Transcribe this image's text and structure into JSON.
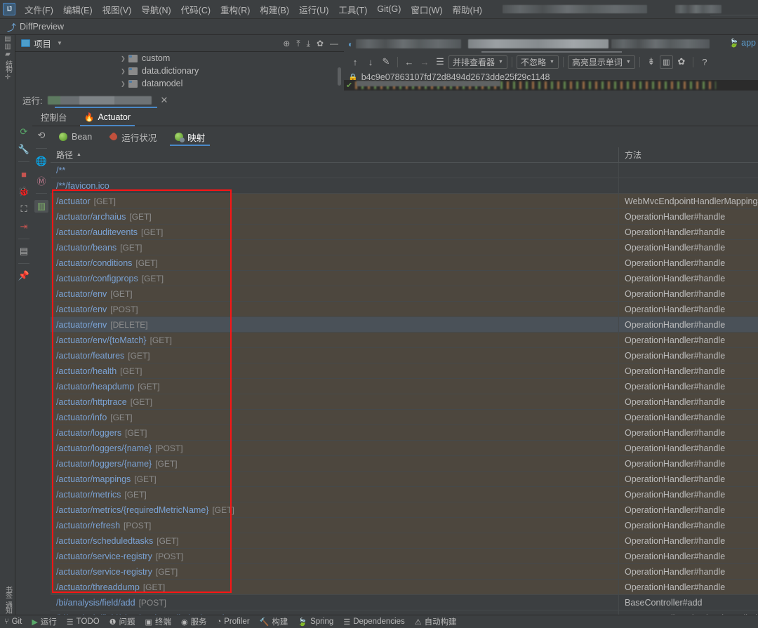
{
  "menubar": {
    "logo": "IJ",
    "items": [
      {
        "label": "文件(F)"
      },
      {
        "label": "编辑(E)"
      },
      {
        "label": "视图(V)"
      },
      {
        "label": "导航(N)"
      },
      {
        "label": "代码(C)"
      },
      {
        "label": "重构(R)"
      },
      {
        "label": "构建(B)"
      },
      {
        "label": "运行(U)"
      },
      {
        "label": "工具(T)"
      },
      {
        "label": "Git(G)"
      },
      {
        "label": "窗口(W)"
      },
      {
        "label": "帮助(H)"
      }
    ]
  },
  "navbar": {
    "icon": "diff-icon",
    "title": "DiffPreview"
  },
  "left_stripe": {
    "top_items": [
      {
        "label": "项目",
        "icon": "project-icon"
      },
      {
        "label": "提交",
        "icon": "commit-icon"
      },
      {
        "label": "结构",
        "icon": "structure-icon"
      },
      {
        "label": "构建变体",
        "icon": "build-variants-icon"
      }
    ],
    "bottom_items": [
      {
        "label": "书签",
        "icon": "bookmark-icon"
      },
      {
        "label": "通知",
        "icon": "notifications-icon"
      }
    ]
  },
  "project_panel": {
    "title": "项目",
    "actions": [
      "locate-icon",
      "expand-all-icon",
      "collapse-all-icon",
      "gear-icon",
      "minimize-icon"
    ],
    "tree": [
      {
        "label": "custom"
      },
      {
        "label": "data.dictionary"
      },
      {
        "label": "datamodel"
      }
    ]
  },
  "diff_panel": {
    "toolbar": {
      "prev_diff": "↑",
      "next_diff": "↓",
      "apply": "edit-icon",
      "accept_left": "←",
      "accept_right": "→",
      "collapse": "align-icon",
      "viewer_mode": "并排查看器",
      "whitespace": "不忽略",
      "highlight": "高亮显示单词",
      "compare": "compare-icon",
      "columns": "columns-icon",
      "settings": "gear-icon",
      "help": "?"
    },
    "file_path": "b4c9e07863107fd72d8494d2673dde25f29c1148",
    "lock_icon": "lock-icon",
    "spring_label": "app"
  },
  "run_panel": {
    "label": "运行:",
    "close_icon": "close-icon",
    "tabs": [
      {
        "label": "控制台",
        "active": false
      },
      {
        "label": "Actuator",
        "active": true,
        "icon": "actuator-icon"
      }
    ],
    "vertical_toolbar": [
      "rerun-icon",
      "settings-wrench-icon",
      "stop-icon",
      "debug-icon",
      "camera-icon",
      "export-icon",
      "layout-icon",
      "pin-icon"
    ],
    "sub_toolbar": [
      "refresh-icon",
      "globe-icon",
      "metrics-icon",
      "chart-icon"
    ],
    "sub_tabs": [
      {
        "label": "Bean",
        "icon": "bean-icon",
        "active": false
      },
      {
        "label": "运行状况",
        "icon": "health-icon",
        "active": false
      },
      {
        "label": "映射",
        "icon": "mappings-icon",
        "active": true
      }
    ]
  },
  "table": {
    "columns": [
      "路径",
      "方法"
    ],
    "sort_indicator": "▲",
    "rows": [
      {
        "path": "/**",
        "verb": "",
        "method": "",
        "highlight": false,
        "selected": false
      },
      {
        "path": "/**/favicon.ico",
        "verb": "",
        "method": "",
        "highlight": false,
        "selected": false
      },
      {
        "path": "/actuator",
        "verb": "[GET]",
        "method": "WebMvcEndpointHandlerMapping#links",
        "highlight": true,
        "selected": false
      },
      {
        "path": "/actuator/archaius",
        "verb": "[GET]",
        "method": "OperationHandler#handle",
        "highlight": true,
        "selected": false
      },
      {
        "path": "/actuator/auditevents",
        "verb": "[GET]",
        "method": "OperationHandler#handle",
        "highlight": true,
        "selected": false
      },
      {
        "path": "/actuator/beans",
        "verb": "[GET]",
        "method": "OperationHandler#handle",
        "highlight": true,
        "selected": false
      },
      {
        "path": "/actuator/conditions",
        "verb": "[GET]",
        "method": "OperationHandler#handle",
        "highlight": true,
        "selected": false
      },
      {
        "path": "/actuator/configprops",
        "verb": "[GET]",
        "method": "OperationHandler#handle",
        "highlight": true,
        "selected": false
      },
      {
        "path": "/actuator/env",
        "verb": "[GET]",
        "method": "OperationHandler#handle",
        "highlight": true,
        "selected": false
      },
      {
        "path": "/actuator/env",
        "verb": "[POST]",
        "method": "OperationHandler#handle",
        "highlight": true,
        "selected": false
      },
      {
        "path": "/actuator/env",
        "verb": "[DELETE]",
        "method": "OperationHandler#handle",
        "highlight": false,
        "selected": true
      },
      {
        "path": "/actuator/env/{toMatch}",
        "verb": "[GET]",
        "method": "OperationHandler#handle",
        "highlight": true,
        "selected": false
      },
      {
        "path": "/actuator/features",
        "verb": "[GET]",
        "method": "OperationHandler#handle",
        "highlight": true,
        "selected": false
      },
      {
        "path": "/actuator/health",
        "verb": "[GET]",
        "method": "OperationHandler#handle",
        "highlight": true,
        "selected": false
      },
      {
        "path": "/actuator/heapdump",
        "verb": "[GET]",
        "method": "OperationHandler#handle",
        "highlight": true,
        "selected": false
      },
      {
        "path": "/actuator/httptrace",
        "verb": "[GET]",
        "method": "OperationHandler#handle",
        "highlight": true,
        "selected": false
      },
      {
        "path": "/actuator/info",
        "verb": "[GET]",
        "method": "OperationHandler#handle",
        "highlight": true,
        "selected": false
      },
      {
        "path": "/actuator/loggers",
        "verb": "[GET]",
        "method": "OperationHandler#handle",
        "highlight": true,
        "selected": false
      },
      {
        "path": "/actuator/loggers/{name}",
        "verb": "[POST]",
        "method": "OperationHandler#handle",
        "highlight": true,
        "selected": false
      },
      {
        "path": "/actuator/loggers/{name}",
        "verb": "[GET]",
        "method": "OperationHandler#handle",
        "highlight": true,
        "selected": false
      },
      {
        "path": "/actuator/mappings",
        "verb": "[GET]",
        "method": "OperationHandler#handle",
        "highlight": true,
        "selected": false
      },
      {
        "path": "/actuator/metrics",
        "verb": "[GET]",
        "method": "OperationHandler#handle",
        "highlight": true,
        "selected": false
      },
      {
        "path": "/actuator/metrics/{requiredMetricName}",
        "verb": "[GET]",
        "method": "OperationHandler#handle",
        "highlight": true,
        "selected": false
      },
      {
        "path": "/actuator/refresh",
        "verb": "[POST]",
        "method": "OperationHandler#handle",
        "highlight": true,
        "selected": false
      },
      {
        "path": "/actuator/scheduledtasks",
        "verb": "[GET]",
        "method": "OperationHandler#handle",
        "highlight": true,
        "selected": false
      },
      {
        "path": "/actuator/service-registry",
        "verb": "[POST]",
        "method": "OperationHandler#handle",
        "highlight": true,
        "selected": false
      },
      {
        "path": "/actuator/service-registry",
        "verb": "[GET]",
        "method": "OperationHandler#handle",
        "highlight": true,
        "selected": false
      },
      {
        "path": "/actuator/threaddump",
        "verb": "[GET]",
        "method": "OperationHandler#handle",
        "highlight": true,
        "selected": false
      },
      {
        "path": "/bi/analysis/field/add",
        "verb": "[POST]",
        "method": "BaseController#add",
        "highlight": false,
        "selected": false
      },
      {
        "path": "/bi/analysis/field/checkUniqueFiledValueExist",
        "verb": "[POST]",
        "method": "BaseController#checkUniqueFiledValueExist",
        "highlight": false,
        "selected": false
      }
    ]
  },
  "annotation": {
    "color": "#fa1515",
    "kind": "red-highlight-box"
  },
  "statusbar": {
    "items": [
      {
        "label": "Git",
        "icon": "git-icon"
      },
      {
        "label": "运行",
        "icon": "run-icon"
      },
      {
        "label": "TODO",
        "icon": "todo-icon"
      },
      {
        "label": "问题",
        "icon": "problems-icon"
      },
      {
        "label": "终端",
        "icon": "terminal-icon"
      },
      {
        "label": "服务",
        "icon": "services-icon"
      },
      {
        "label": "Profiler",
        "icon": "profiler-icon"
      },
      {
        "label": "构建",
        "icon": "build-icon"
      },
      {
        "label": "Spring",
        "icon": "spring-icon"
      },
      {
        "label": "Dependencies",
        "icon": "dependencies-icon"
      },
      {
        "label": "自动构建",
        "icon": "autobuild-icon"
      }
    ]
  },
  "colors": {
    "background": "#3c3f41",
    "highlight_row": "#4d473e",
    "selected_row": "#4a5158",
    "path_link": "#7aa2d4",
    "accent": "#4a88c7",
    "annotation_red": "#fa1515"
  }
}
